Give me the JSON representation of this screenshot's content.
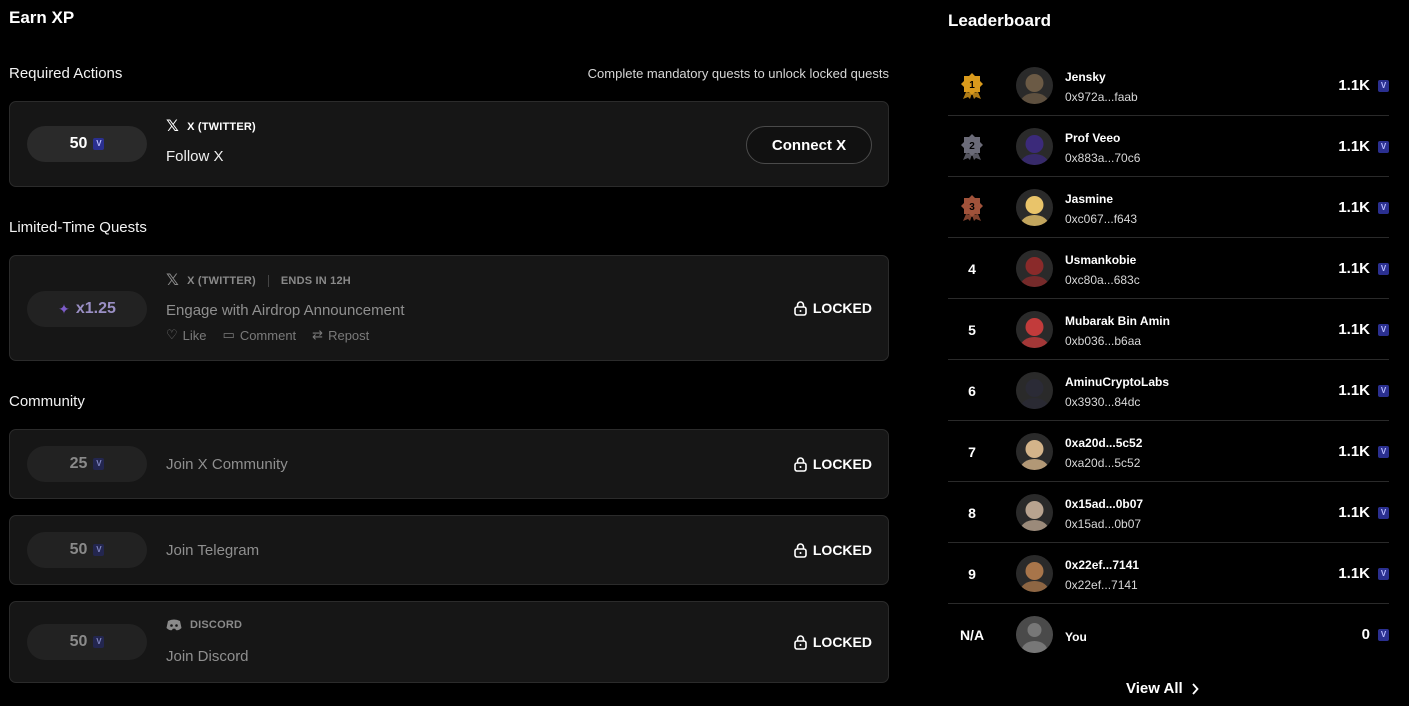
{
  "earn": {
    "title": "Earn XP",
    "required": {
      "title": "Required Actions",
      "note": "Complete mandatory quests to unlock locked quests",
      "quest": {
        "xp": "50",
        "platform": "X (TWITTER)",
        "task": "Follow X",
        "button": "Connect X"
      }
    },
    "limited": {
      "title": "Limited-Time Quests",
      "quest": {
        "boost": "x1.25",
        "platform": "X (TWITTER)",
        "ends": "ENDS IN 12H",
        "task": "Engage with Airdrop Announcement",
        "actions": {
          "like": "Like",
          "comment": "Comment",
          "repost": "Repost"
        },
        "status": "LOCKED"
      }
    },
    "community": {
      "title": "Community",
      "quests": [
        {
          "xp": "25",
          "task": "Join X Community",
          "status": "LOCKED"
        },
        {
          "xp": "50",
          "task": "Join Telegram",
          "status": "LOCKED"
        },
        {
          "xp": "50",
          "platform": "DISCORD",
          "task": "Join Discord",
          "status": "LOCKED"
        }
      ]
    }
  },
  "leaderboard": {
    "title": "Leaderboard",
    "rows": [
      {
        "rank": "1",
        "name": "Jensky",
        "address": "0x972a...faab",
        "xp": "1.1K"
      },
      {
        "rank": "2",
        "name": "Prof Veeo",
        "address": "0x883a...70c6",
        "xp": "1.1K"
      },
      {
        "rank": "3",
        "name": "Jasmine",
        "address": "0xc067...f643",
        "xp": "1.1K"
      },
      {
        "rank": "4",
        "name": "Usmankobie",
        "address": "0xc80a...683c",
        "xp": "1.1K"
      },
      {
        "rank": "5",
        "name": "Mubarak Bin Amin",
        "address": "0xb036...b6aa",
        "xp": "1.1K"
      },
      {
        "rank": "6",
        "name": "AminuCryptoLabs",
        "address": "0x3930...84dc",
        "xp": "1.1K"
      },
      {
        "rank": "7",
        "name": "0xa20d...5c52",
        "address": "0xa20d...5c52",
        "xp": "1.1K"
      },
      {
        "rank": "8",
        "name": "0x15ad...0b07",
        "address": "0x15ad...0b07",
        "xp": "1.1K"
      },
      {
        "rank": "9",
        "name": "0x22ef...7141",
        "address": "0x22ef...7141",
        "xp": "1.1K"
      },
      {
        "rank": "N/A",
        "name": "You",
        "address": "",
        "xp": "0"
      }
    ],
    "view_all": "View All"
  },
  "icons": {
    "token": "v-token-icon",
    "x": "x-logo-icon",
    "lock": "lock-icon",
    "discord": "discord-icon",
    "medal": "medal-icon"
  },
  "colors": {
    "background": "#000000",
    "card": "#161616",
    "token": "#2a2f8f",
    "boost": "#7d5cc9",
    "gold": "#d99a1c",
    "silver": "#6b6b78",
    "bronze": "#a0523a"
  }
}
